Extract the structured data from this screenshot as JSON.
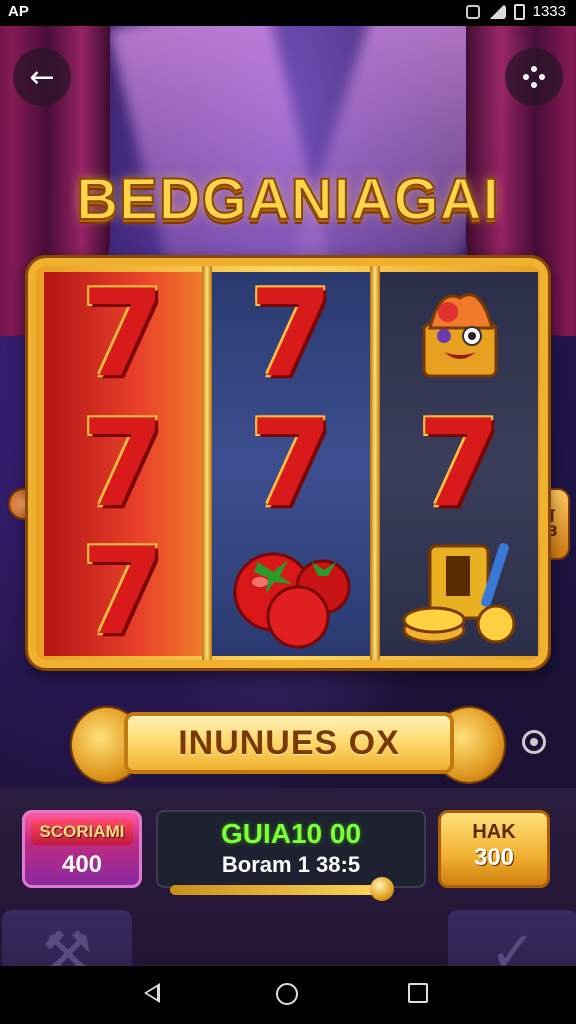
{
  "status_bar": {
    "carrier": "AP",
    "time": "1333"
  },
  "game": {
    "title": "BEDGANIAGAI",
    "reels": [
      [
        "7",
        "7",
        "7"
      ],
      [
        "7",
        "7",
        "tomatoes"
      ],
      [
        "face",
        "7",
        "gold-coins"
      ]
    ],
    "reel_icons": {
      "face": "jester-face-icon",
      "tomatoes": "tomato-icon",
      "gold-coins": "coin-icon"
    },
    "side_label": "3",
    "banner_text": "INUNUES OX"
  },
  "hud": {
    "score_label": "SCORIAMI",
    "score_value": "400",
    "center_top": "GUIA10 00",
    "center_bottom": "Boram 1 38:5",
    "bet_label": "HAK",
    "bet_value": "300"
  },
  "colors": {
    "accent_gold": "#f0b030",
    "seven_red": "#d81a1a",
    "win_green": "#7aff3a"
  }
}
